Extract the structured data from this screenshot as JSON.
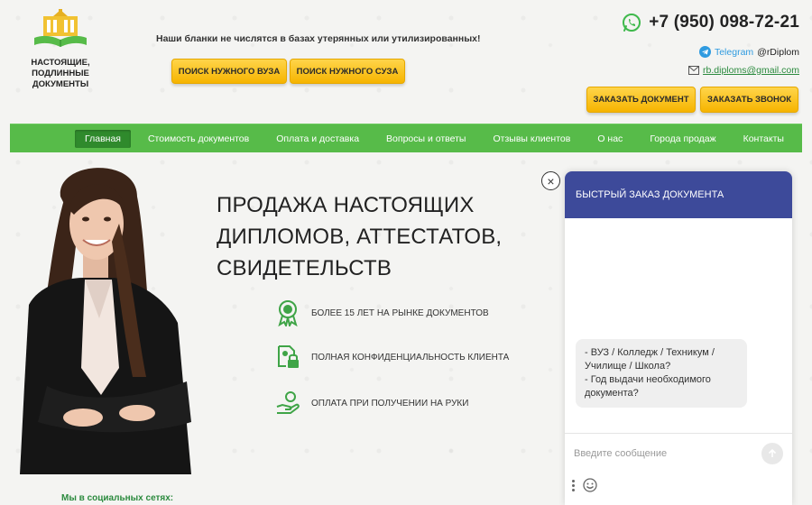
{
  "header": {
    "logo_text": "Настоящие, подлинные документы",
    "tagline": "Наши бланки не числятся в базах утерянных или утилизированных!",
    "search_vuz": "Поиск нужного вуза",
    "search_suz": "Поиск нужного суза",
    "phone": "+7 (950) 098-72-21",
    "telegram_label": "Telegram",
    "telegram_handle": "@rDiplom",
    "email": "rb.diploms@gmail.com",
    "order_document": "Заказать документ",
    "order_call": "Заказать звонок"
  },
  "nav": {
    "items": [
      {
        "label": "Главная"
      },
      {
        "label": "Стоимость документов"
      },
      {
        "label": "Оплата и доставка"
      },
      {
        "label": "Вопросы и ответы"
      },
      {
        "label": "Отзывы клиентов"
      },
      {
        "label": "О нас"
      },
      {
        "label": "Города продаж"
      },
      {
        "label": "Контакты"
      }
    ]
  },
  "hero": {
    "title": "Продажа настоящих дипломов, аттестатов, свидетельств",
    "features": [
      {
        "text": "Более 15 лет на рынке документов",
        "icon": "award-ribbon-icon"
      },
      {
        "text": "Полная конфиденциальность клиента",
        "icon": "lock-document-icon"
      },
      {
        "text": "Оплата при получении на руки",
        "icon": "hand-coin-icon"
      }
    ]
  },
  "social": {
    "label": "Мы в социальных сетях:"
  },
  "chat": {
    "header": "Быстрый заказ документа",
    "message_line1": "- ВУЗ / Колледж / Техникум / Училище / Школа?",
    "message_line2": "- Год выдачи необходимого документа?",
    "input_placeholder": "Введите сообщение",
    "input_value": "",
    "close_symbol": "×"
  },
  "colors": {
    "nav_green": "#57bb49",
    "nav_active": "#2f8a2c",
    "button_yellow": "#f6b400",
    "chat_header": "#3d4a9a",
    "link_green": "#2b8a3e",
    "telegram_blue": "#2f9be0"
  }
}
